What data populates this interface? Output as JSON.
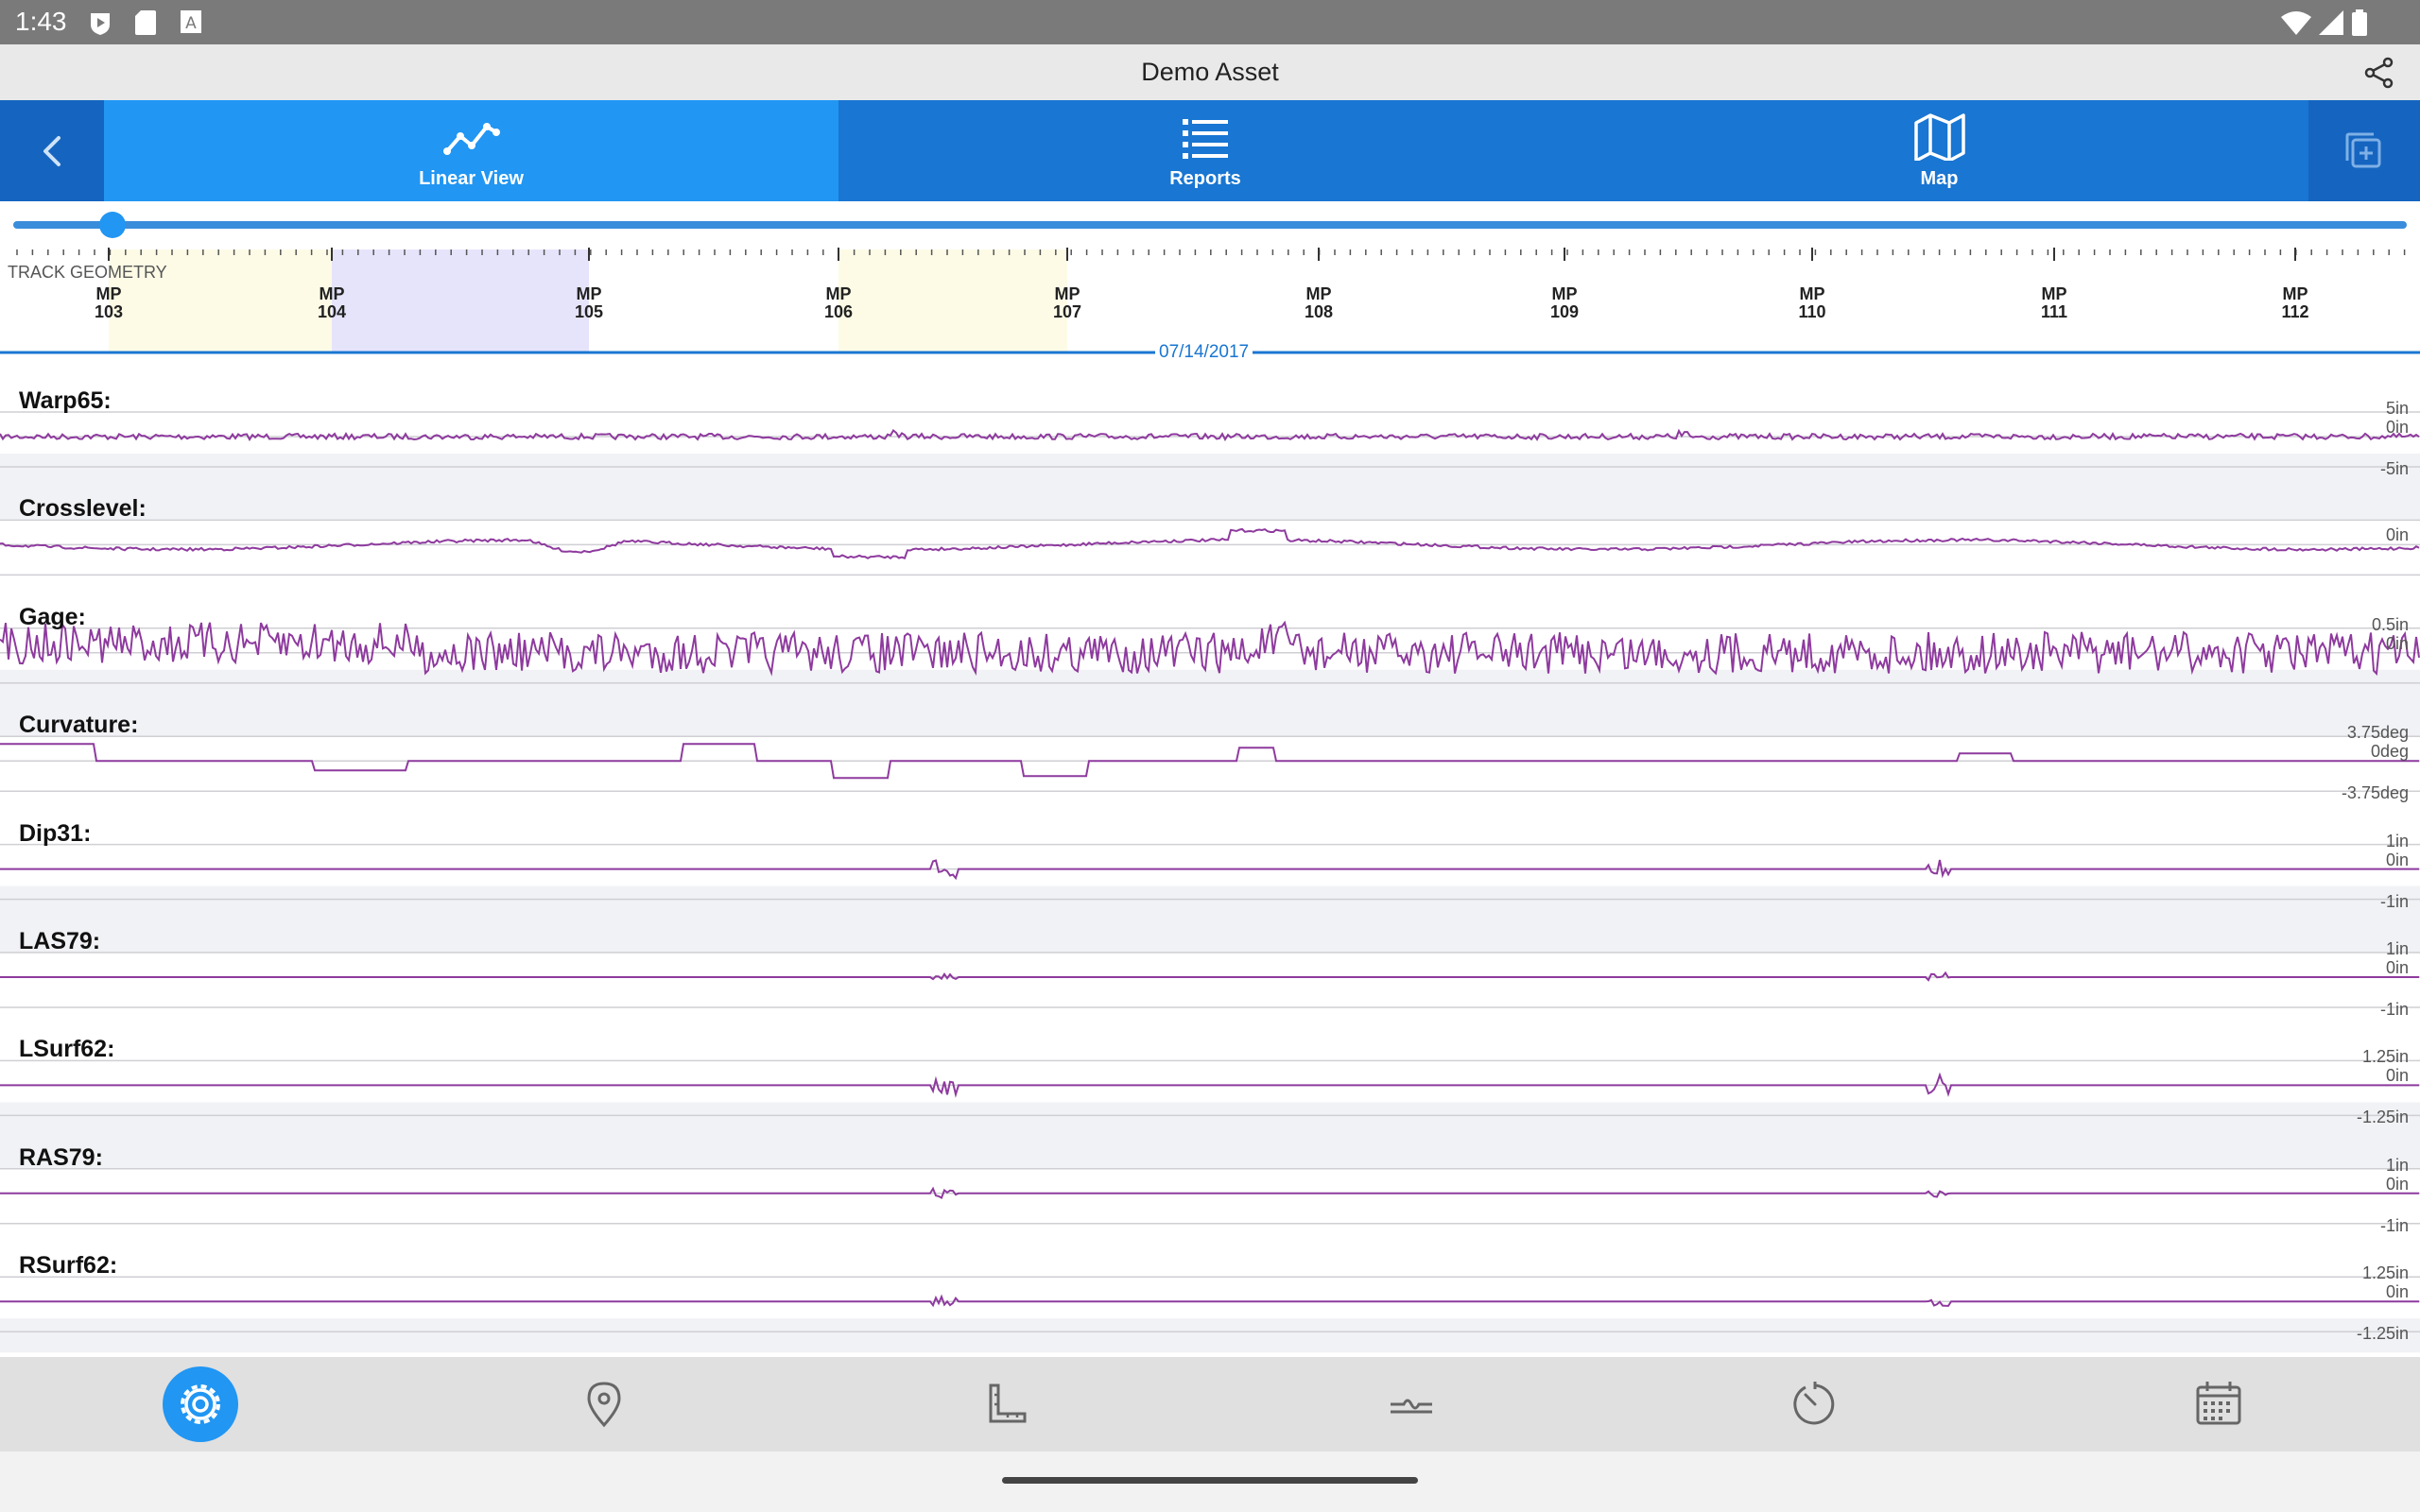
{
  "status_bar": {
    "time": "1:43"
  },
  "app": {
    "title": "Demo Asset"
  },
  "tabs": [
    {
      "label": "Linear View",
      "icon": "line-chart-icon",
      "active": true
    },
    {
      "label": "Reports",
      "icon": "list-icon",
      "active": false
    },
    {
      "label": "Map",
      "icon": "map-icon",
      "active": false
    }
  ],
  "ruler": {
    "section_label": "TRACK GEOMETRY",
    "date": "07/14/2017",
    "mileposts": [
      {
        "line1": "MP",
        "line2": "103"
      },
      {
        "line1": "MP",
        "line2": "104"
      },
      {
        "line1": "MP",
        "line2": "105"
      },
      {
        "line1": "MP",
        "line2": "106"
      },
      {
        "line1": "MP",
        "line2": "107"
      },
      {
        "line1": "MP",
        "line2": "108"
      },
      {
        "line1": "MP",
        "line2": "109"
      },
      {
        "line1": "MP",
        "line2": "110"
      },
      {
        "line1": "MP",
        "line2": "111"
      },
      {
        "line1": "MP",
        "line2": "112"
      }
    ]
  },
  "rows": [
    {
      "label": "Warp65:",
      "top": "5in",
      "mid": "0in",
      "bottom": "-5in"
    },
    {
      "label": "Crosslevel:",
      "top": "",
      "mid": "0in",
      "bottom": ""
    },
    {
      "label": "Gage:",
      "top": "0.5in",
      "mid": "0in",
      "bottom": ""
    },
    {
      "label": "Curvature:",
      "top": "3.75deg",
      "mid": "0deg",
      "bottom": "-3.75deg"
    },
    {
      "label": "Dip31:",
      "top": "1in",
      "mid": "0in",
      "bottom": "-1in"
    },
    {
      "label": "LAS79:",
      "top": "1in",
      "mid": "0in",
      "bottom": "-1in"
    },
    {
      "label": "LSurf62:",
      "top": "1.25in",
      "mid": "0in",
      "bottom": "-1.25in"
    },
    {
      "label": "RAS79:",
      "top": "1in",
      "mid": "0in",
      "bottom": "-1in"
    },
    {
      "label": "RSurf62:",
      "top": "1.25in",
      "mid": "0in",
      "bottom": "-1.25in"
    }
  ],
  "bottom_nav": [
    {
      "icon": "settings-icon",
      "active": true
    },
    {
      "icon": "location-pin-icon",
      "active": false
    },
    {
      "icon": "ruler-icon",
      "active": false
    },
    {
      "icon": "track-profile-icon",
      "active": false
    },
    {
      "icon": "speed-gauge-icon",
      "active": false
    },
    {
      "icon": "calendar-icon",
      "active": false
    }
  ],
  "colors": {
    "trace": "#8e3a9e",
    "tab_bar": "#1976d2",
    "tab_active": "#2196f3",
    "accent": "#2196f3"
  }
}
